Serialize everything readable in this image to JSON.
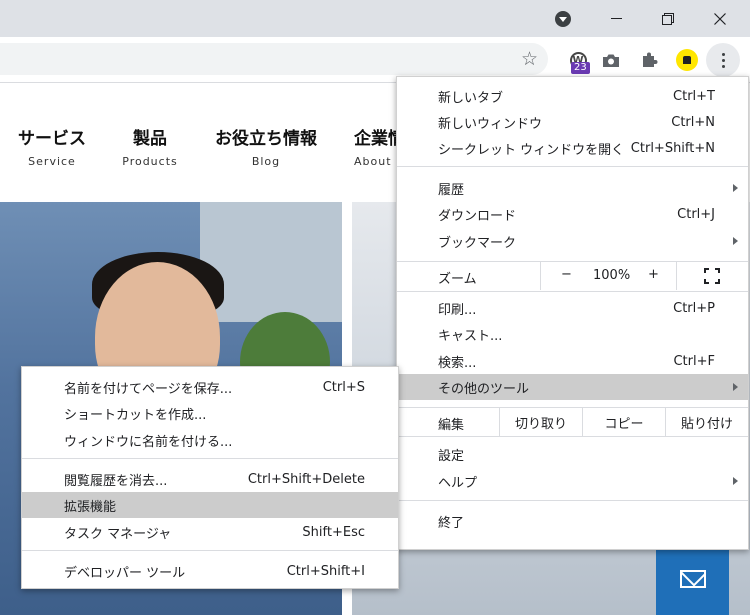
{
  "titlebar": {
    "buttons": [
      "tab-search",
      "minimize",
      "restore",
      "close"
    ]
  },
  "toolbar": {
    "extensions": {
      "wordpress_badge": "23"
    }
  },
  "site": {
    "nav": [
      {
        "jp": "サービス",
        "en": "Service"
      },
      {
        "jp": "製品",
        "en": "Products"
      },
      {
        "jp": "お役立ち情報",
        "en": "Blog"
      },
      {
        "jp": "企業情",
        "en": "About"
      }
    ],
    "colors": {
      "mail_button": "#1f6fb8"
    }
  },
  "menu": {
    "items": [
      {
        "label": "新しいタブ",
        "shortcut": "Ctrl+T"
      },
      {
        "label": "新しいウィンドウ",
        "shortcut": "Ctrl+N"
      },
      {
        "label": "シークレット ウィンドウを開く",
        "shortcut": "Ctrl+Shift+N"
      },
      {
        "label": "履歴",
        "shortcut": ""
      },
      {
        "label": "ダウンロード",
        "shortcut": "Ctrl+J"
      },
      {
        "label": "ブックマーク",
        "shortcut": ""
      },
      {
        "label": "印刷...",
        "shortcut": "Ctrl+P"
      },
      {
        "label": "キャスト...",
        "shortcut": ""
      },
      {
        "label": "検索...",
        "shortcut": "Ctrl+F"
      },
      {
        "label": "その他のツール",
        "shortcut": ""
      },
      {
        "label": "設定",
        "shortcut": ""
      },
      {
        "label": "ヘルプ",
        "shortcut": ""
      },
      {
        "label": "終了",
        "shortcut": ""
      }
    ],
    "zoom": {
      "label": "ズーム",
      "minus": "−",
      "value": "100%",
      "plus": "+"
    },
    "edit": {
      "label": "編集",
      "cut": "切り取り",
      "copy": "コピー",
      "paste": "貼り付け"
    },
    "highlighted": "その他のツール"
  },
  "submenu": {
    "items": [
      {
        "label": "名前を付けてページを保存...",
        "shortcut": "Ctrl+S"
      },
      {
        "label": "ショートカットを作成...",
        "shortcut": ""
      },
      {
        "label": "ウィンドウに名前を付ける...",
        "shortcut": ""
      },
      {
        "label": "閲覧履歴を消去...",
        "shortcut": "Ctrl+Shift+Delete"
      },
      {
        "label": "拡張機能",
        "shortcut": ""
      },
      {
        "label": "タスク マネージャ",
        "shortcut": "Shift+Esc"
      },
      {
        "label": "デベロッパー ツール",
        "shortcut": "Ctrl+Shift+I"
      }
    ],
    "highlighted": "拡張機能"
  }
}
